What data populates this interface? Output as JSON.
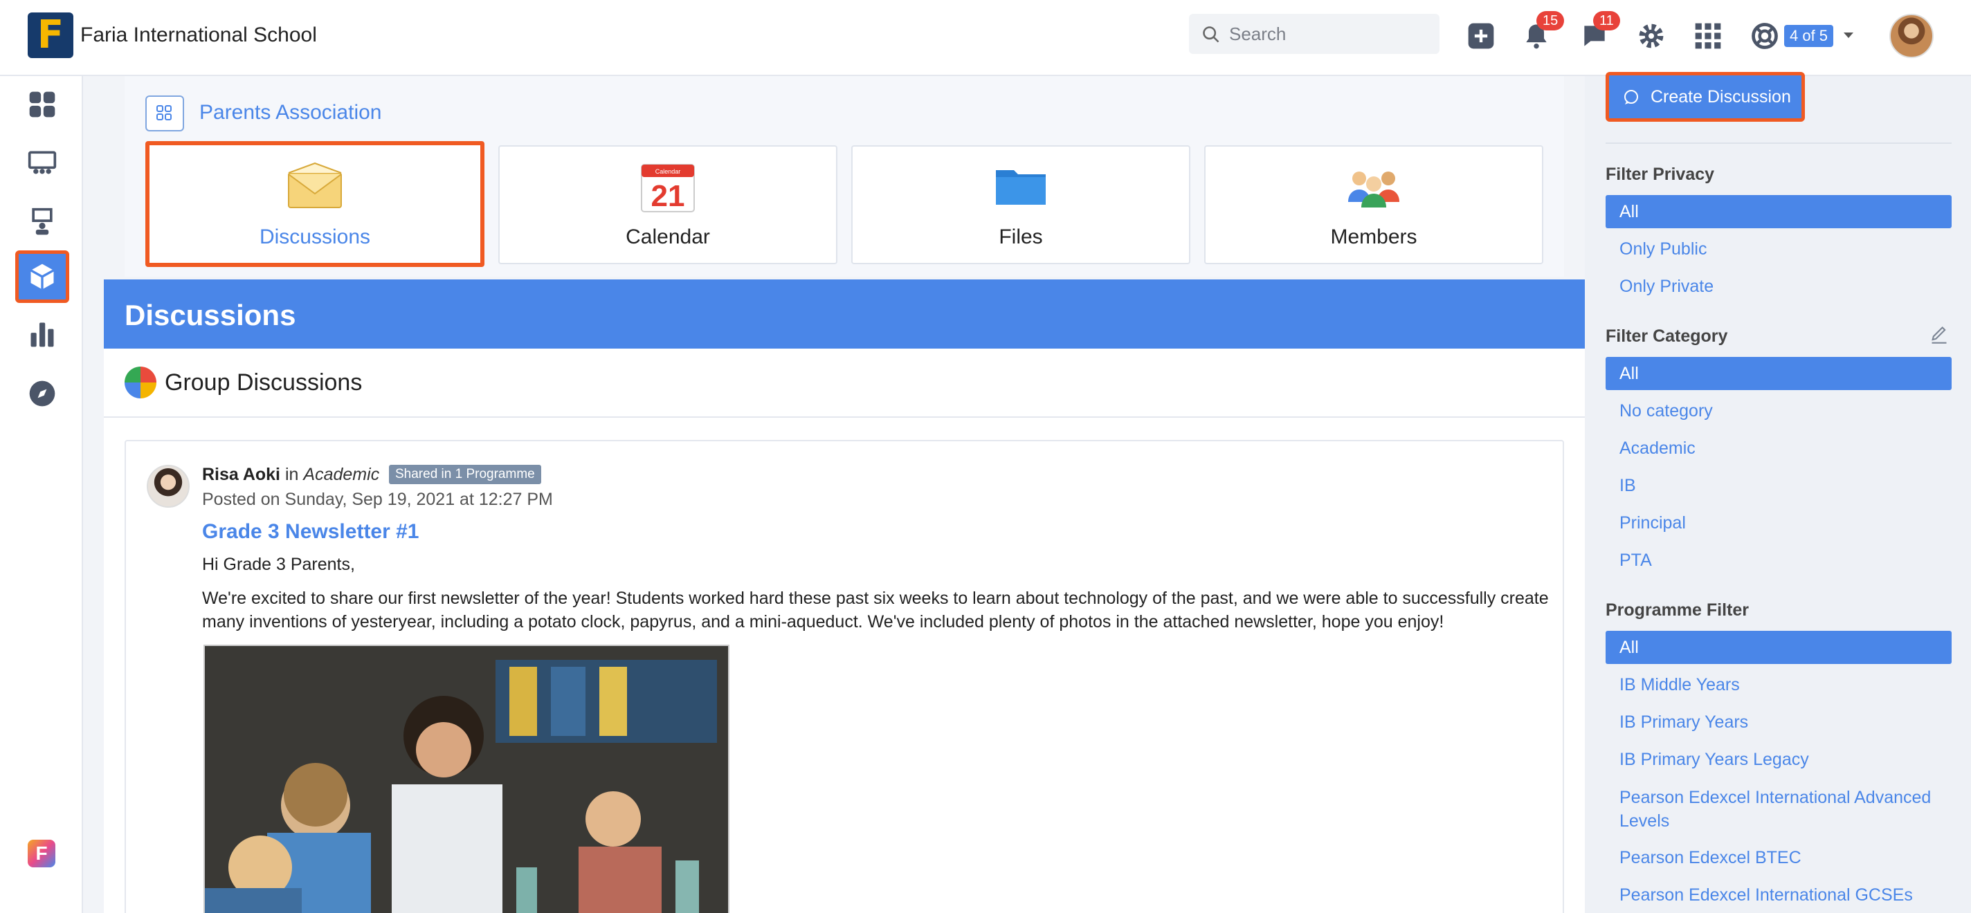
{
  "topbar": {
    "logo_letter": "F",
    "school_name": "Faria International School",
    "search_placeholder": "Search",
    "notifications_count": "15",
    "messages_count": "11",
    "counter": "4 of 5"
  },
  "tabs": {
    "group_name": "Parents Association",
    "items": [
      {
        "label": "Discussions"
      },
      {
        "label": "Calendar"
      },
      {
        "label": "Files"
      },
      {
        "label": "Members"
      }
    ],
    "calendar_day": "21",
    "calendar_caption": "Calendar"
  },
  "discussions": {
    "header": "Discussions",
    "group_title": "Group Discussions",
    "post": {
      "author": "Risa Aoki",
      "in_label": "in",
      "category": "Academic",
      "shared_badge": "Shared in 1 Programme",
      "posted": "Posted on Sunday, Sep 19, 2021 at 12:27 PM",
      "title": "Grade 3 Newsletter #1",
      "greeting": "Hi Grade 3 Parents,",
      "body": "We're excited to share our first newsletter of the year! Students worked hard these past six weeks to learn about technology of the past, and we were able to successfully create many inventions of yesteryear, including a potato clock, papyrus, and a mini-aqueduct. We've included plenty of photos in the attached newsletter, hope you enjoy!"
    }
  },
  "rightbar": {
    "create_button": "Create Discussion",
    "privacy": {
      "title": "Filter Privacy",
      "items": [
        "All",
        "Only Public",
        "Only Private"
      ]
    },
    "category": {
      "title": "Filter Category",
      "items": [
        "All",
        "No category",
        "Academic",
        "IB",
        "Principal",
        "PTA"
      ]
    },
    "programme": {
      "title": "Programme Filter",
      "items": [
        "All",
        "IB Middle Years",
        "IB Primary Years",
        "IB Primary Years Legacy",
        "Pearson Edexcel International Advanced Levels",
        "Pearson Edexcel BTEC",
        "Pearson Edexcel International GCSEs"
      ]
    }
  },
  "colors": {
    "accent": "#4a86e8",
    "highlight": "#f05a22",
    "badge": "#e8423a"
  }
}
